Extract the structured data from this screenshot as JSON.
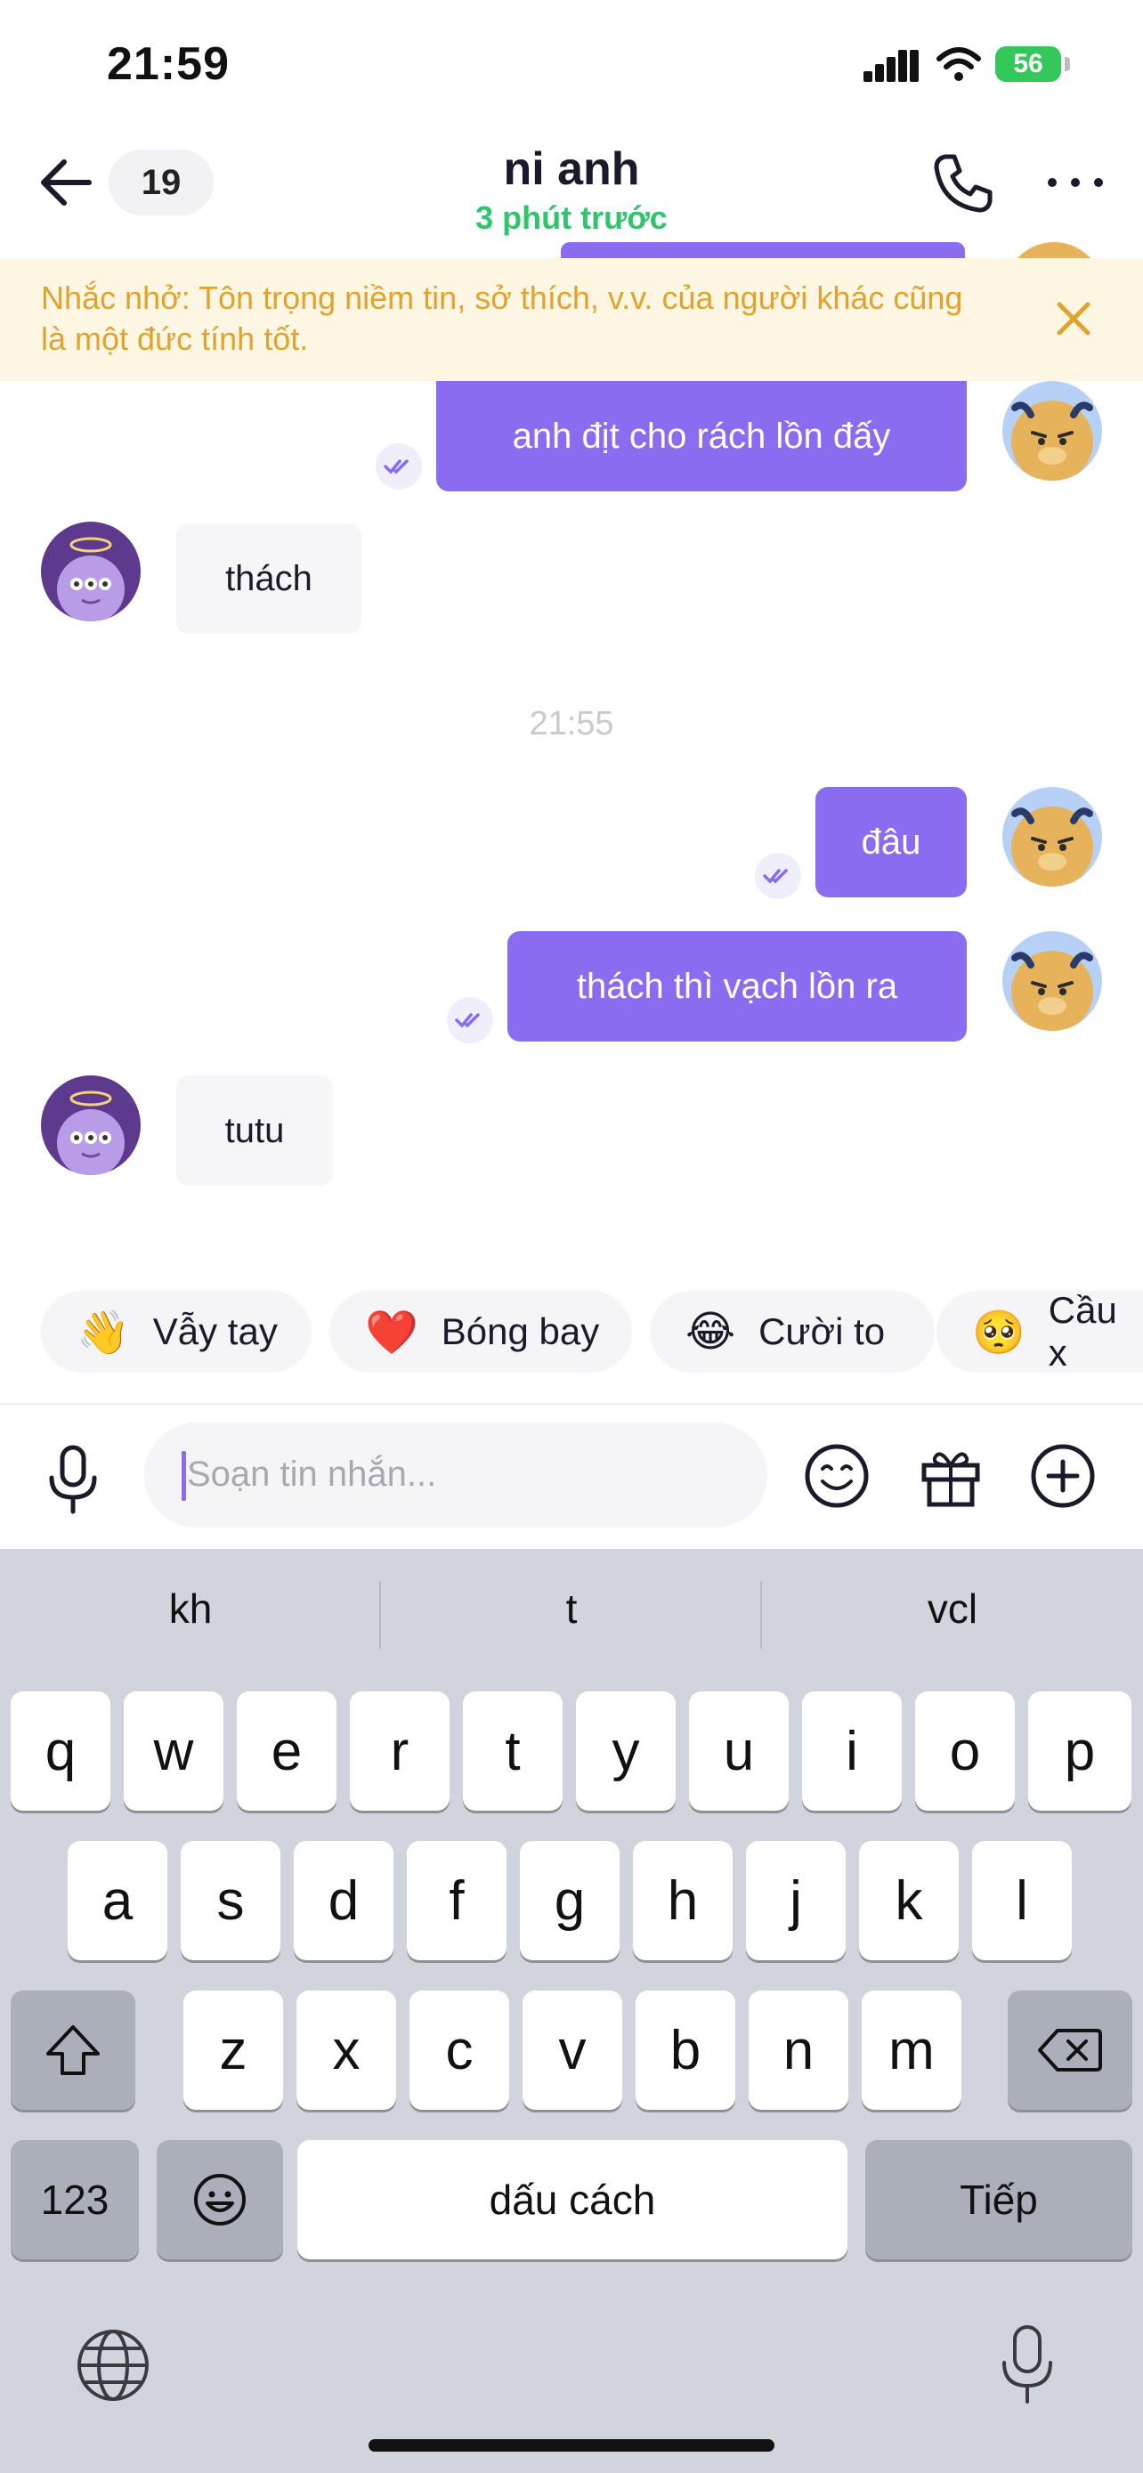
{
  "status_bar": {
    "time": "21:59",
    "battery": "56"
  },
  "header": {
    "unread_count": "19",
    "name": "ni anh",
    "presence": "3 phút trước"
  },
  "reminder": {
    "text": "Nhắc nhở: Tôn trọng niềm tin, sở thích, v.v. của người khác cũng là một đức tính tốt."
  },
  "messages": [
    {
      "direction": "out",
      "text": "anh địt cho rách lồn đấy"
    },
    {
      "direction": "in",
      "text": "thách"
    },
    {
      "type": "timestamp",
      "text": "21:55"
    },
    {
      "direction": "out",
      "text": "đâu"
    },
    {
      "direction": "out",
      "text": "thách thì vạch lồn ra"
    },
    {
      "direction": "in",
      "text": "tutu"
    }
  ],
  "quick_reactions": [
    {
      "emoji": "👋",
      "label": "Vẫy tay"
    },
    {
      "emoji": "❤️",
      "label": "Bóng bay"
    },
    {
      "emoji": "😂",
      "label": "Cười to"
    },
    {
      "emoji": "🥺",
      "label": "Cầu x"
    }
  ],
  "composer": {
    "placeholder": "Soạn tin nhắn..."
  },
  "keyboard": {
    "suggestions": [
      "kh",
      "t",
      "vcl"
    ],
    "row1": [
      "q",
      "w",
      "e",
      "r",
      "t",
      "y",
      "u",
      "i",
      "o",
      "p"
    ],
    "row2": [
      "a",
      "s",
      "d",
      "f",
      "g",
      "h",
      "j",
      "k",
      "l"
    ],
    "row3": [
      "z",
      "x",
      "c",
      "v",
      "b",
      "n",
      "m"
    ],
    "numbers_key": "123",
    "space_key": "dấu cách",
    "return_key": "Tiếp"
  },
  "colors": {
    "accent": "#8a6cf0",
    "presence": "#31c46b",
    "reminder_text": "#e0a32e",
    "reminder_bg": "#fdf6e3"
  }
}
